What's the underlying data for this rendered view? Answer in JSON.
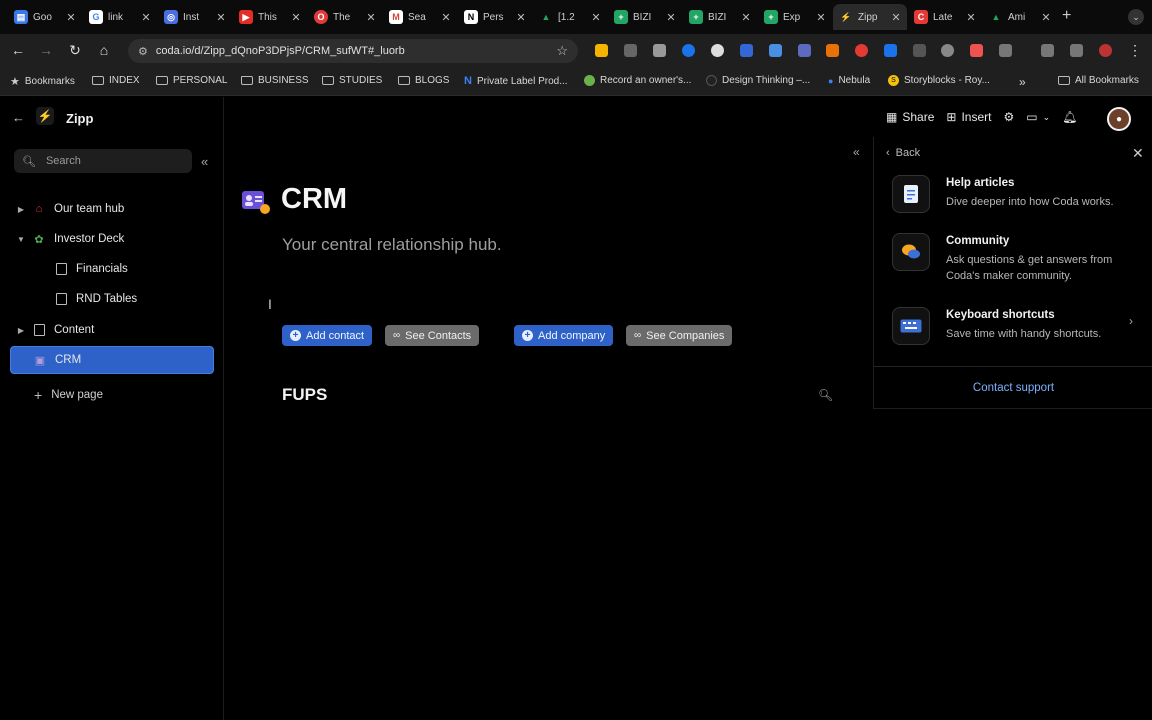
{
  "browser": {
    "tabs": [
      {
        "label": "Goo",
        "icon": "google-docs-icon",
        "color": "#3b78e7"
      },
      {
        "label": "link",
        "icon": "google-icon",
        "color": "#ffffff"
      },
      {
        "label": "Inst",
        "icon": "instagram-icon",
        "color": "#4a6ee0"
      },
      {
        "label": "This",
        "icon": "youtube-icon",
        "color": "#e52d27"
      },
      {
        "label": "The",
        "icon": "opera-icon",
        "color": "#e03a3a"
      },
      {
        "label": "Sea",
        "icon": "gmail-icon",
        "color": "#d44638"
      },
      {
        "label": "Pers",
        "icon": "notion-icon",
        "color": "#ffffff"
      },
      {
        "label": "[1.2",
        "icon": "google-drive-icon",
        "color": "#1fa463"
      },
      {
        "label": "BIZI",
        "icon": "google-sheets-icon",
        "color": "#23a566"
      },
      {
        "label": "BIZI",
        "icon": "google-sheets-icon",
        "color": "#23a566"
      },
      {
        "label": "Exp",
        "icon": "google-sheets-icon",
        "color": "#23a566"
      },
      {
        "label": "Zipp",
        "icon": "coda-icon",
        "color": "#7fd3ff",
        "active": true
      },
      {
        "label": "Late",
        "icon": "coda-red-icon",
        "color": "#e53935"
      },
      {
        "label": "Ami",
        "icon": "drive-green-icon",
        "color": "#1fa463"
      }
    ],
    "url": "coda.io/d/Zipp_dQnoP3DPjsP/CRM_sufWT#_luorb",
    "bookmarks": [
      {
        "label": "Bookmarks",
        "type": "star"
      },
      {
        "label": "INDEX",
        "type": "folder"
      },
      {
        "label": "PERSONAL",
        "type": "folder"
      },
      {
        "label": "BUSINESS",
        "type": "folder"
      },
      {
        "label": "STUDIES",
        "type": "folder"
      },
      {
        "label": "BLOGS",
        "type": "folder"
      },
      {
        "label": "Private Label Prod...",
        "type": "site",
        "color": "#3b82f6"
      },
      {
        "label": "Record an owner's...",
        "type": "site",
        "color": "#6ab04c"
      },
      {
        "label": "Design Thinking –...",
        "type": "site",
        "color": "#222222"
      },
      {
        "label": "Nebula",
        "type": "site",
        "color": "#3b82f6"
      },
      {
        "label": "Storyblocks - Roy...",
        "type": "site",
        "color": "#f4c20d"
      }
    ],
    "all_bookmarks": "All Bookmarks"
  },
  "sidebar": {
    "doc_title": "Zipp",
    "search_placeholder": "Search",
    "items": [
      {
        "label": "Our team hub",
        "icon": "home-icon",
        "caret": "right",
        "level": 0
      },
      {
        "label": "Investor Deck",
        "icon": "plant-icon",
        "caret": "down",
        "level": 0
      },
      {
        "label": "Financials",
        "icon": "doc-icon",
        "caret": "",
        "level": 1
      },
      {
        "label": "RND Tables",
        "icon": "doc-icon",
        "caret": "",
        "level": 1
      },
      {
        "label": "Content",
        "icon": "doc-icon",
        "caret": "right",
        "level": 0
      },
      {
        "label": "CRM",
        "icon": "contact-card-icon",
        "caret": "",
        "level": 0,
        "selected": true
      }
    ],
    "new_page": "New page"
  },
  "page": {
    "title": "CRM",
    "subtitle": "Your central relationship hub.",
    "buttons": [
      {
        "label": "Add contact",
        "style": "primary",
        "icon": "plus-circle-icon"
      },
      {
        "label": "See Contacts",
        "style": "secondary",
        "icon": "link-icon"
      },
      {
        "label": "Add company",
        "style": "primary",
        "icon": "plus-circle-icon"
      },
      {
        "label": "See Companies",
        "style": "secondary",
        "icon": "link-icon"
      }
    ],
    "section_title": "FUPS"
  },
  "header": {
    "share": "Share",
    "insert": "Insert"
  },
  "help_panel": {
    "back": "Back",
    "items": [
      {
        "title": "Help articles",
        "desc": "Dive deeper into how Coda works.",
        "icon": "article-icon"
      },
      {
        "title": "Community",
        "desc": "Ask questions & get answers from Coda's maker community.",
        "icon": "chat-bubbles-icon"
      },
      {
        "title": "Keyboard shortcuts",
        "desc": "Save time with handy shortcuts.",
        "icon": "keyboard-icon"
      }
    ],
    "contact_support": "Contact support"
  },
  "colors": {
    "accent": "#2f62c9",
    "secondary_button": "#6b6b6b",
    "link": "#7fb0ff"
  }
}
